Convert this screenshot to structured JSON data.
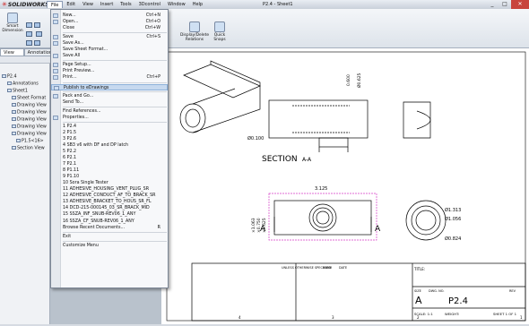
{
  "app": {
    "logo_text": "SOLIDWORKS",
    "document_title": "P2.4 - Sheet1"
  },
  "menubar": [
    "File",
    "Edit",
    "View",
    "Insert",
    "Tools",
    "3Dcontrol",
    "Window",
    "Help"
  ],
  "window_controls": [
    "_",
    "□",
    "✕"
  ],
  "ribbon": {
    "smart_dimension": "Smart Dimension",
    "display_delete_relations": "Display/Delete Relations",
    "quick_snaps": "Quick Snaps"
  },
  "tabs": [
    "View Layout",
    "Annotation"
  ],
  "tree": {
    "root": "P2.4",
    "items": [
      "Annotations",
      "Sheet1",
      "Sheet Format",
      "Drawing View",
      "Drawing View",
      "Drawing View",
      "Drawing View",
      "Drawing View",
      "P1.5<16>",
      "Section View"
    ]
  },
  "file_menu": [
    {
      "label": "New...",
      "shortcut": "Ctrl+N",
      "icon": "new-doc-icon"
    },
    {
      "label": "Open...",
      "shortcut": "Ctrl+O",
      "icon": "open-folder-icon"
    },
    {
      "label": "Close",
      "shortcut": "Ctrl+W",
      "icon": ""
    },
    {
      "sep": true
    },
    {
      "label": "Save",
      "shortcut": "Ctrl+S",
      "icon": "save-icon"
    },
    {
      "label": "Save As...",
      "shortcut": "",
      "icon": "save-as-icon"
    },
    {
      "label": "Save Sheet Format...",
      "shortcut": "",
      "icon": ""
    },
    {
      "label": "Save All",
      "shortcut": "",
      "icon": "save-all-icon"
    },
    {
      "sep": true
    },
    {
      "label": "Page Setup...",
      "shortcut": "",
      "icon": "page-setup-icon"
    },
    {
      "label": "Print Preview...",
      "shortcut": "",
      "icon": "print-preview-icon"
    },
    {
      "label": "Print...",
      "shortcut": "Ctrl+P",
      "icon": "print-icon"
    },
    {
      "sep": true
    },
    {
      "label": "Publish to eDrawings",
      "shortcut": "",
      "icon": "edrawings-icon",
      "highlight": true
    },
    {
      "sep": true
    },
    {
      "label": "Pack and Go...",
      "shortcut": "",
      "icon": "pack-and-go-icon"
    },
    {
      "label": "Send To...",
      "shortcut": "",
      "icon": ""
    },
    {
      "sep": true
    },
    {
      "label": "Find References...",
      "shortcut": "",
      "icon": ""
    },
    {
      "label": "Properties...",
      "shortcut": "",
      "icon": "properties-icon"
    },
    {
      "sep": true
    },
    {
      "label": "1 P2.4",
      "shortcut": "",
      "icon": ""
    },
    {
      "label": "2 P1.5",
      "shortcut": "",
      "icon": ""
    },
    {
      "label": "3 P2.6",
      "shortcut": "",
      "icon": ""
    },
    {
      "label": "4 SB3 v6 with DF and DP latch",
      "shortcut": "",
      "icon": ""
    },
    {
      "label": "5 P2.2",
      "shortcut": "",
      "icon": ""
    },
    {
      "label": "6 P2.1",
      "shortcut": "",
      "icon": ""
    },
    {
      "label": "7 P2.1",
      "shortcut": "",
      "icon": ""
    },
    {
      "label": "8 P1.11",
      "shortcut": "",
      "icon": ""
    },
    {
      "label": "9 P1.10",
      "shortcut": "",
      "icon": ""
    },
    {
      "label": "10 Sora Single Tester",
      "shortcut": "",
      "icon": ""
    },
    {
      "label": "11 ADHESIVE_HOUSING_VENT_PLUG_SR",
      "shortcut": "",
      "icon": ""
    },
    {
      "label": "12 ADHESIVE_CONDUCT_AF_TO_BRACK_SR",
      "shortcut": "",
      "icon": ""
    },
    {
      "label": "13 ADHESIVE_BRACKET_TO_HOUS_SR_FL",
      "shortcut": "",
      "icon": ""
    },
    {
      "label": "14 DCD-215-000145_03_SR_BRACK_MID",
      "shortcut": "",
      "icon": ""
    },
    {
      "label": "15 SSZA_INF_SNUB-REV06_1_ANY",
      "shortcut": "",
      "icon": ""
    },
    {
      "label": "16 SSZA_CF_SNUB-REV06_1_ANY",
      "shortcut": "",
      "icon": ""
    },
    {
      "label": "Browse Recent Documents...",
      "shortcut": "R",
      "icon": ""
    },
    {
      "sep": true
    },
    {
      "label": "Exit",
      "shortcut": "",
      "icon": ""
    },
    {
      "sep": true
    },
    {
      "label": "Customize Menu",
      "shortcut": "",
      "icon": ""
    }
  ],
  "drawing": {
    "section_label": "SECTION",
    "section_suffix": "A-A",
    "cut_letter": "A",
    "dim_top_radius": "Ø0.625",
    "dim_top_height": "0.600",
    "dim_phi100": "Ø0.100",
    "dim_1063": "×1.063",
    "dim_0750": "×0.750",
    "dim_0625": "×0.625",
    "dim_width": "3.125",
    "dim_1313": "Ø1.313",
    "dim_1056": "Ø1.056",
    "dim_0824": "Ø0.824",
    "title_block": {
      "header": "UNLESS OTHERWISE SPECIFIED:",
      "name": "NAME",
      "date": "DATE",
      "title": "TITLE:",
      "size_label": "SIZE",
      "dwg_label": "DWG. NO.",
      "rev_label": "REV",
      "size": "A",
      "dwg_no": "P2.4",
      "scale": "SCALE: 1:1",
      "weight": "WEIGHT:",
      "sheet": "SHEET 1 OF 1"
    },
    "border_numbers": [
      "4",
      "3",
      "2",
      "1"
    ]
  }
}
